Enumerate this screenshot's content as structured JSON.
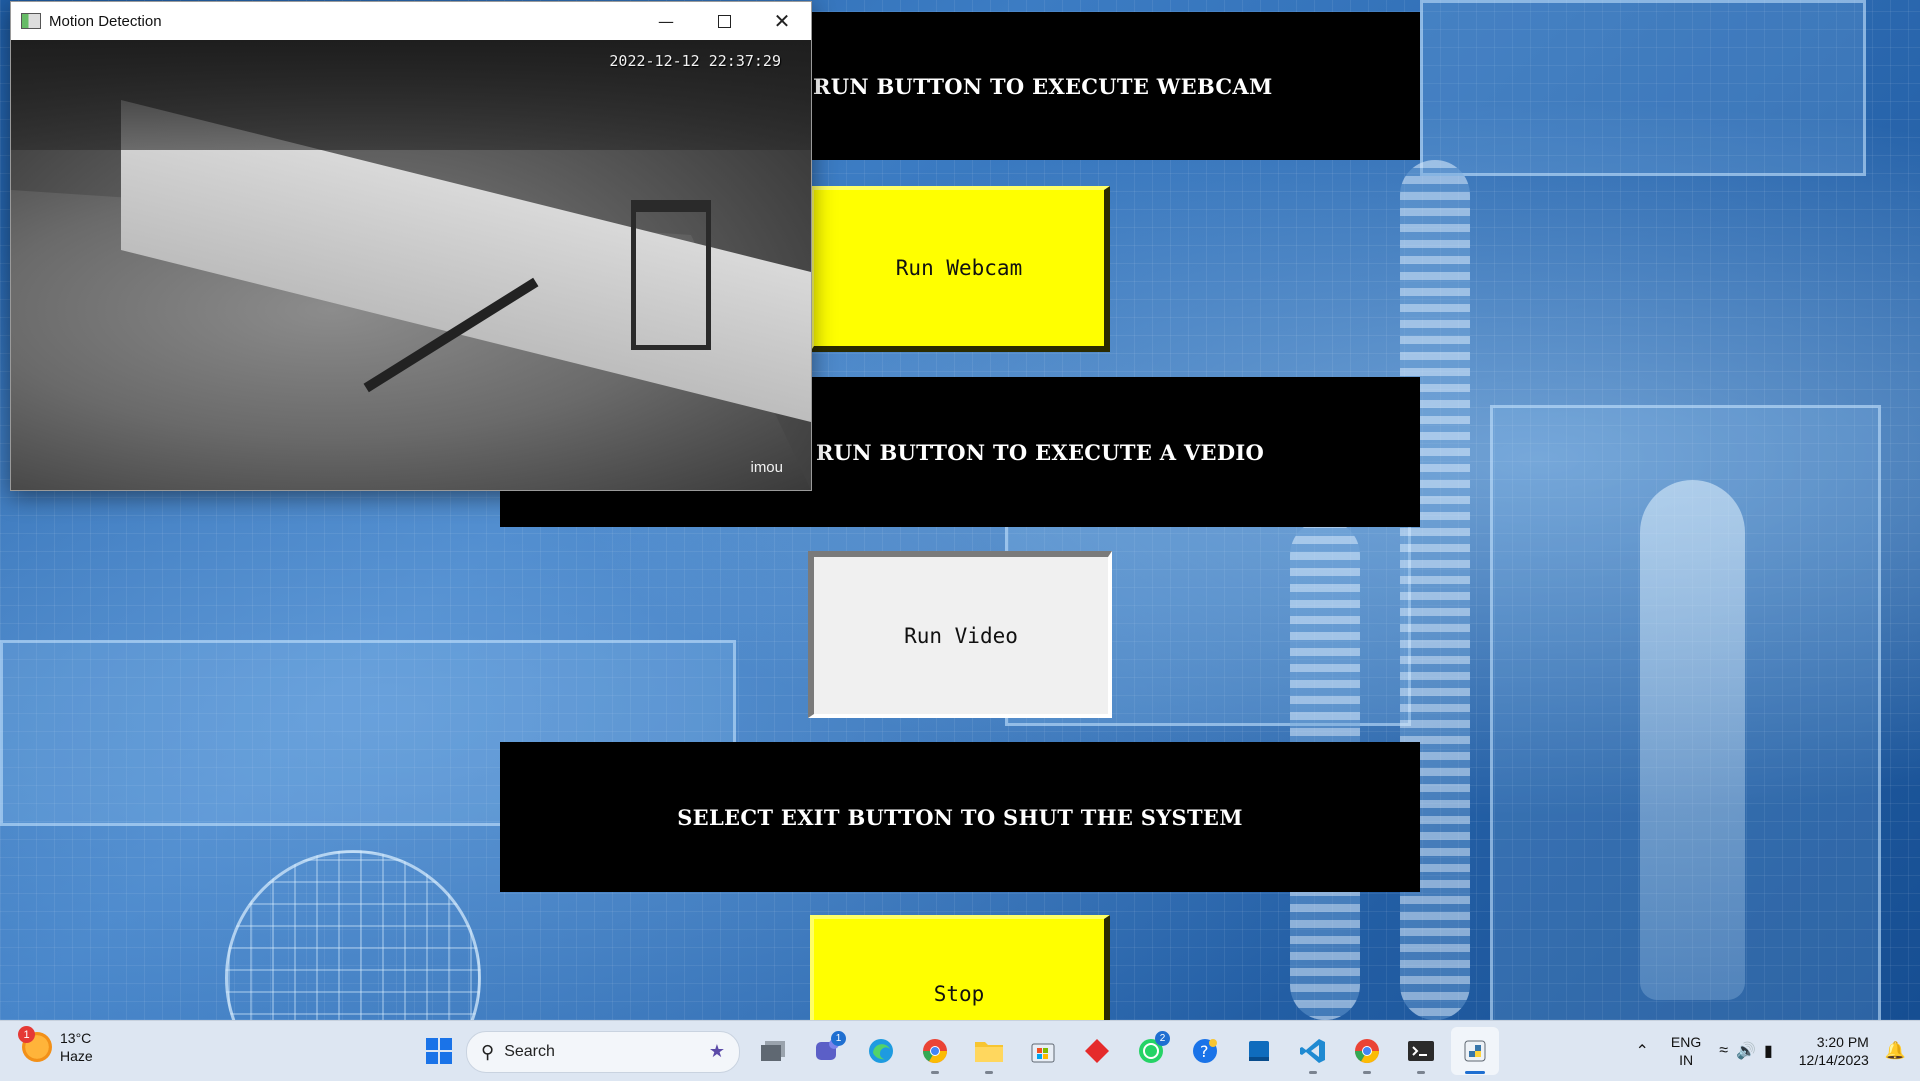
{
  "window": {
    "title": "Motion Detection",
    "feed_timestamp": "2022-12-12 22:37:29",
    "feed_brand": "imou"
  },
  "app": {
    "banner_webcam": "RUN BUTTON TO EXECUTE WEBCAM",
    "button_webcam": "Run Webcam",
    "banner_video": "RUN BUTTON TO EXECUTE A VEDIO",
    "button_video": "Run Video",
    "banner_exit": "SELECT EXIT BUTTON TO SHUT THE SYSTEM",
    "button_stop": "Stop"
  },
  "taskbar": {
    "weather_temp": "13°C",
    "weather_desc": "Haze",
    "weather_badge": "1",
    "search_label": "Search",
    "teams_badge": "1",
    "whatsapp_badge": "2",
    "lang_top": "ENG",
    "lang_bottom": "IN",
    "time": "3:20 PM",
    "date": "12/14/2023"
  }
}
